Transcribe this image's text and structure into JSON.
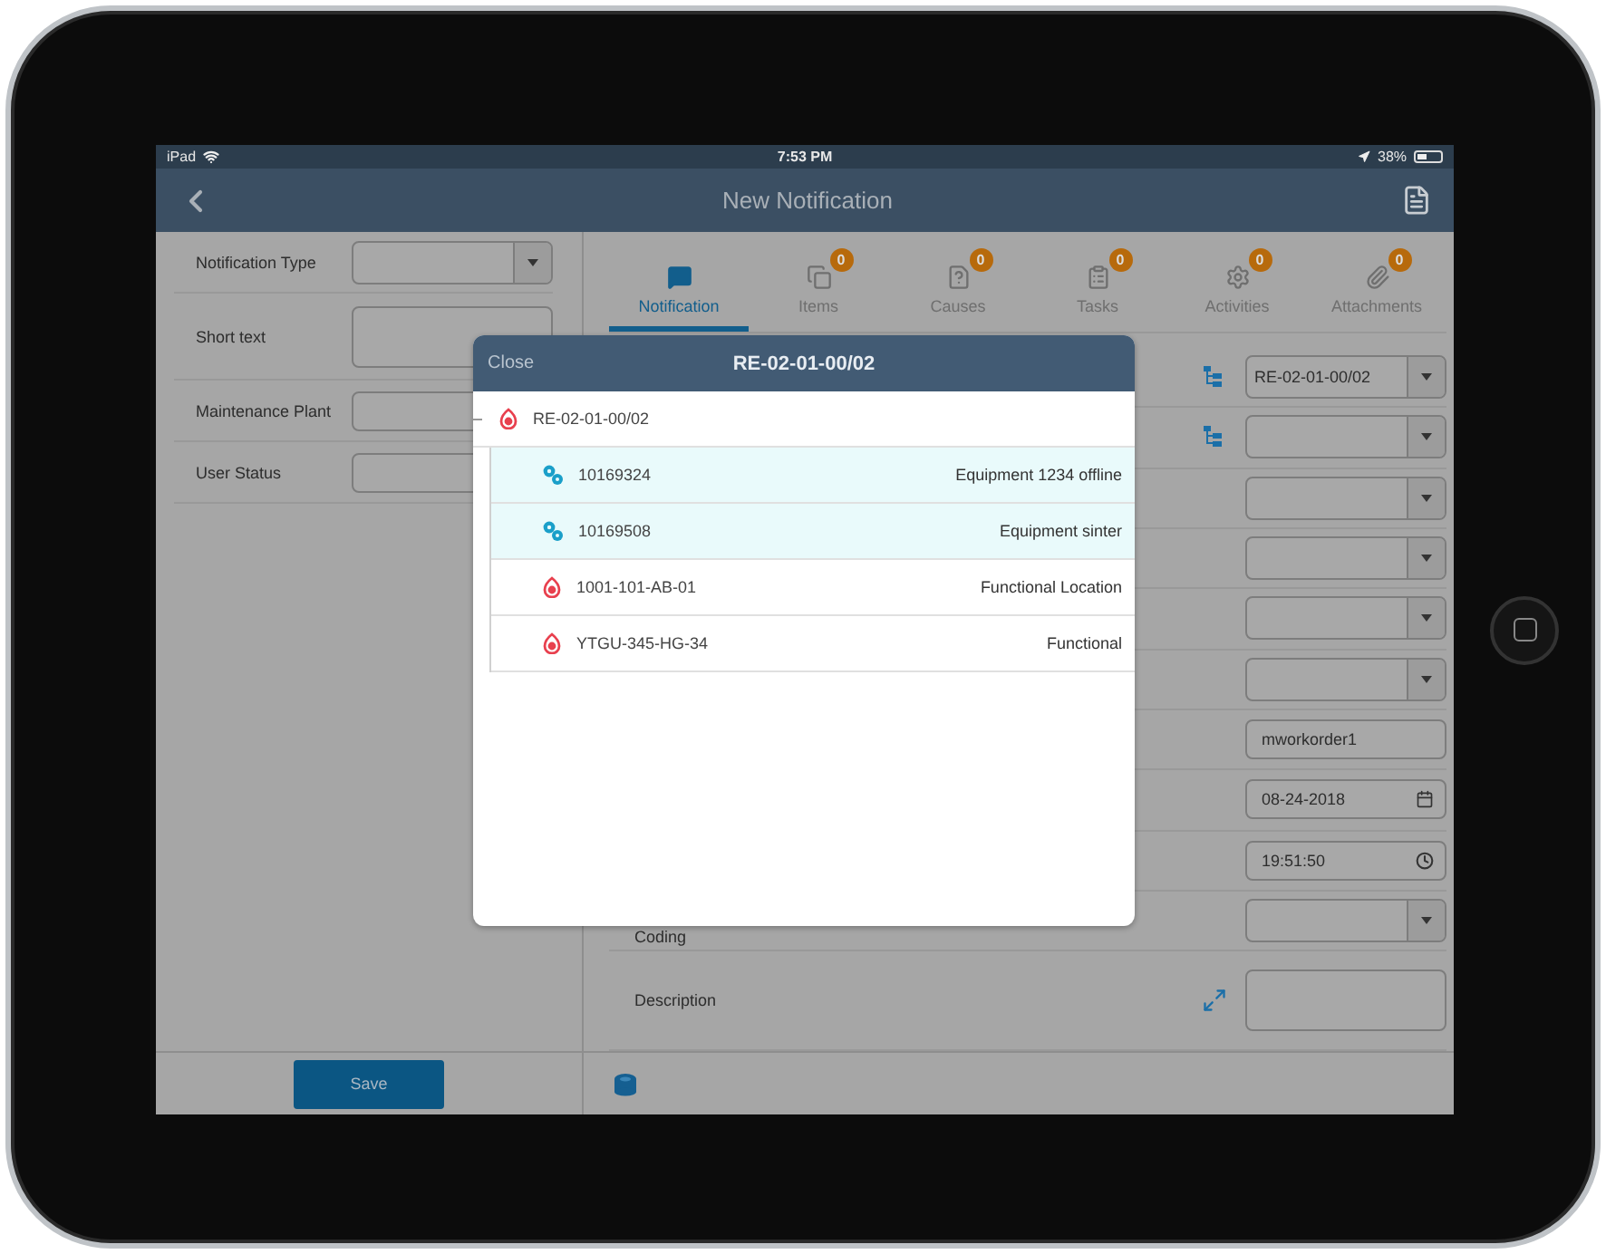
{
  "status_bar": {
    "carrier": "iPad",
    "time": "7:53 PM",
    "battery": "38%"
  },
  "nav_bar": {
    "title": "New Notification"
  },
  "header_fields": [
    {
      "label": "Notification Type",
      "kind": "select"
    },
    {
      "label": "Short text",
      "kind": "textarea"
    },
    {
      "label": "Maintenance Plant",
      "kind": "text"
    },
    {
      "label": "User Status",
      "kind": "text"
    }
  ],
  "tabs": [
    {
      "label": "Notification",
      "selected": true
    },
    {
      "label": "Items",
      "badge": "0",
      "selected": false
    },
    {
      "label": "Causes",
      "badge": "0",
      "selected": false
    },
    {
      "label": "Tasks",
      "badge": "0",
      "selected": false
    },
    {
      "label": "Activities",
      "badge": "0",
      "selected": false
    },
    {
      "label": "Attachments",
      "badge": "0",
      "selected": false
    }
  ],
  "detail_fields": [
    {
      "kind": "hierarchy-select",
      "value": "RE-02-01-00/02"
    },
    {
      "kind": "hierarchy-select"
    },
    {
      "kind": "select"
    },
    {
      "kind": "select"
    },
    {
      "kind": "select"
    },
    {
      "kind": "select"
    },
    {
      "kind": "text",
      "value": "mworkorder1"
    },
    {
      "kind": "date",
      "value": "08-24-2018"
    },
    {
      "kind": "time",
      "value": "19:51:50"
    },
    {
      "kind": "select",
      "label": "Coding"
    },
    {
      "kind": "expandable-textarea",
      "label": "Description"
    }
  ],
  "picker": {
    "close": "Close",
    "title": "RE-02-01-00/02",
    "root": {
      "code": "RE-02-01-00/02",
      "kind": "location",
      "children": [
        {
          "code": "10169324",
          "description": "Equipment 1234 offline",
          "kind": "equipment"
        },
        {
          "code": "10169508",
          "description": "Equipment sinter",
          "kind": "equipment"
        },
        {
          "code": "1001-101-AB-01",
          "description": "Functional Location",
          "kind": "location"
        },
        {
          "code": "YTGU-345-HG-34",
          "description": "Functional",
          "kind": "location"
        }
      ]
    }
  },
  "footer": {
    "save": "Save"
  }
}
